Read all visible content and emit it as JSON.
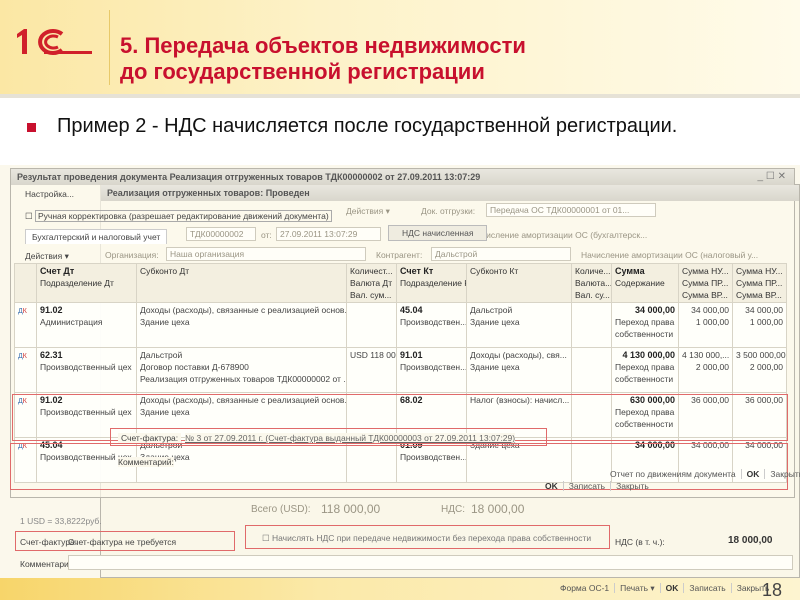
{
  "slide": {
    "title_line1": "5. Передача объектов недвижимости",
    "title_line2": "до государственной регистрации",
    "bullet": "Пример 2 - НДС начисляется после государственной регистрации.",
    "page_number": "18",
    "logo_text": "1С"
  },
  "colors": {
    "accent": "#c8102e",
    "highlight": "#e06a6a"
  },
  "back_window": {
    "title": "Реализация отгруженных товаров: Проведен",
    "actions": "Действия ▾",
    "number": "ТДК00000002",
    "date_label": "от:",
    "date": "27.09.2011 13:07:29",
    "nds_button": "НДС начисленная",
    "org_label": "Организация:",
    "org": "Наша организация",
    "contractor_label": "Контрагент:",
    "contractor": "Дальстрой",
    "shipdoc_label": "Док. отгрузки:",
    "shipdoc": "Передача ОС ТДК00000001 от 01...",
    "total_label": "Всего (USD):",
    "total": "118 000,00",
    "vat_label": "НДС:",
    "vat": "18 000,00",
    "tab1": "Начисление амортизации ОС (бухгалтерск...",
    "tab2": "Начисление амортизации ОС (налоговый у...",
    "rate": "1 USD = 33,8222руб.",
    "invoice_label": "Счет-фактура:",
    "invoice_value": "Счет-фактура не требуется",
    "comment_label": "Комментарий:",
    "vat_incl_label": "НДС (в т. ч.):",
    "vat_incl": "18 000,00",
    "vat_checkbox": "Начислять НДС при передаче недвижимости без перехода права собственности",
    "footer_buttons": [
      "Форма ОС-1",
      "Печать ▾",
      "OK",
      "Записать",
      "Закрыть"
    ]
  },
  "result_window": {
    "title": "Результат проведения документа Реализация отгруженных товаров ТДК00000002 от 27.09.2011 13:07:29",
    "settings": "Настройка...",
    "manual": "Ручная корректировка (разрешает редактирование движений документа)",
    "tab": "Бухгалтерский и налоговый учет",
    "actions": "Действия ▾",
    "columns": {
      "dt": "Счет Дт",
      "dt2": "Подразделение Дт",
      "sub_dt": "Субконто Дт",
      "qty_dt": "Количест...",
      "cur_dt": "Валюта Дт",
      "valsum_dt": "Вал. сум...",
      "kt": "Счет Кт",
      "kt2": "Подразделение Кт",
      "sub_kt": "Субконто Кт",
      "qty_kt": "Количе...",
      "cur_kt": "Валюта...",
      "valsum_kt": "Вал. су...",
      "sum": "Сумма",
      "content": "Содержание",
      "nu1": "Сумма НУ...",
      "pr1": "Сумма ПР...",
      "vr1": "Сумма ВР...",
      "nu2": "Сумма НУ...",
      "pr2": "Сумма ПР...",
      "vr2": "Сумма ВР..."
    },
    "rows": [
      {
        "dt": "91.02",
        "dt_dept": "Администрация",
        "sub_dt": [
          "Доходы (расходы), связанные с реализацией основ...",
          "Здание цеха",
          ""
        ],
        "qty": "",
        "kt": "45.04",
        "kt_dept": "Производствен... цех",
        "sub_kt": [
          "Дальстрой",
          "Здание цеха"
        ],
        "sum": "34 000,00",
        "content": "Переход права собственности",
        "nu": [
          "34 000,00",
          "1 000,00"
        ],
        "nu2": [
          "34 000,00",
          "1 000,00"
        ]
      },
      {
        "dt": "62.31",
        "dt_dept": "Производственный цех",
        "sub_dt": [
          "Дальстрой",
          "Договор поставки Д-678900",
          "Реализация отгруженных товаров ТДК00000002 от ..."
        ],
        "qty": "USD 118 000,00",
        "kt": "91.01",
        "kt_dept": "Производствен... цех",
        "sub_kt": [
          "Доходы (расходы), свя...",
          "Здание цеха"
        ],
        "sum": "4 130 000,00",
        "content": "Переход права собственности",
        "nu": [
          "4 130 000,...",
          "2 000,00"
        ],
        "nu2": [
          "3 500 000,00",
          "2 000,00"
        ]
      },
      {
        "dt": "91.02",
        "dt_dept": "Производственный цех",
        "sub_dt": [
          "Доходы (расходы), связанные с реализацией основ...",
          "Здание цеха",
          ""
        ],
        "qty": "",
        "kt": "68.02",
        "kt_dept": "",
        "sub_kt": [
          "Налог (взносы): начисл...",
          ""
        ],
        "sum": "630 000,00",
        "content": "Переход права собственности",
        "nu": [
          "",
          "36 000,00"
        ],
        "nu2": [
          "",
          "36 000,00"
        ]
      },
      {
        "dt": "45.04",
        "dt_dept": "Производственный цех",
        "sub_dt": [
          "Дальстрой",
          "Здание цеха",
          ""
        ],
        "qty": "",
        "kt": "01.09",
        "kt_dept": "Производствен... цех",
        "sub_kt": [
          "Здание цеха",
          ""
        ],
        "sum": "34 000,00",
        "content": "",
        "nu": [
          "34 000,00",
          ""
        ],
        "nu2": [
          "34 000,00",
          ""
        ]
      }
    ],
    "invoice_label": "Счет-фактура:",
    "invoice_link": "№ 3 от 27.09.2011 г. (Счет-фактура выданный ТДК00000003 от 27.09.2011 13:07:29)",
    "comment_label": "Комментарий:",
    "mid_buttons": [
      "OK",
      "Записать",
      "Закрыть"
    ],
    "report_buttons": [
      "Отчет по движениям документа",
      "OK",
      "Закрыть"
    ]
  }
}
